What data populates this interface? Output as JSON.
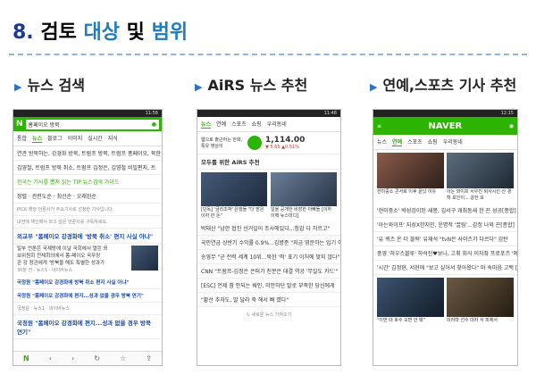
{
  "title": {
    "num": "8.",
    "p1": "검토",
    "p2": "대상",
    "p3": "및",
    "p4": "범위"
  },
  "headers": [
    "뉴스 검색",
    "AiRS 뉴스 추천",
    "연예,스포츠 기사 추천"
  ],
  "p1": {
    "status_time": "11:58",
    "search_query": "홈페이오 방북",
    "tabs": [
      "통합",
      "뉴스",
      "블로그",
      "이미지",
      "실시간",
      "지식"
    ],
    "lines": [
      "연관  방북하는, 강경화 방북, 트럼프 방북, 트럼프 폼페이오, 북한",
      "김영철, 트럼프 방북 취소, 트럼프 김정은, 김영철 비밀편지, 트",
      "한국는 기사를 뽑져 읽는 TIP 뉴스검색 가이드",
      "정렬 · 관련도순 · 최신순 · 오래된순",
      "PICK 해당 언론사가 주요기사로 선정한 기사입니다.",
      "내언에 해인해서 보고 싶은 언론사를 구독하세요."
    ],
    "headline1": "외교부 \"폼페이오 강경화에 '방북 취소' 편지 사실 아냐\"",
    "snippet1": [
      "일부 언론은 국제방에 이날 국회에서 열린 외",
      "보위원회 전체회의에서 폼-페이오 국무장",
      "관 강 장관에게 '방북을 해도 특별한 성과가",
      "30분 전 · 뉴스1 · 네이버뉴스"
    ],
    "headline2": "국정원 \"폼페이오 강경화에 방북 취소 편지 사실 아냐\"",
    "headline3": "국정원 \"폼페이오 강경화에 편지...성과 없을 경우 방북 연기\"",
    "meta3": "국정원 · 뉴스1 · 네이버뉴스",
    "headline4": "국정원 \"폼페이오 강경화에 편지...성과 없을 경우 방북 연기\""
  },
  "p2": {
    "status_time": "11:48",
    "tabs": [
      "뉴스",
      "연예",
      "스포츠",
      "쇼핑",
      "우리동네"
    ],
    "weather": [
      "웹으로 출근하는 한화, 특유 영상이",
      "1,114.00",
      "▼ 5.65  ▲0.51%"
    ],
    "section_title": "모두를 위한 AiRS 추천",
    "cards": [
      "[단독] '금리조작' 은행들 \"더 받은 이자 반 돈\"",
      "일을 공개한 비장한 아빠들 [이하 이해 뉴스미디]"
    ],
    "items": [
      "박태산 \"남한 협진 선거일이 조사에있다...청감 다 치르고\"",
      "국민연금 상반기 수익률 0.9%...김병준 \"지금 영문하는 입기 이거..",
      "송영무 \"군 전력 세계 10위...북한 '적' 표기 이처에 맞지 않다\"",
      "CNN \"트럼프-김정은 은퍼가 친분은 대결 역공 '무일도 카드'\"",
      "[ESC] 언제 참 안되는 쉐인, 미안하단 말로 부족한 당신에게",
      "\"황선 추자도, 발 달라 죽 해서 빠 졌다\""
    ],
    "more": "새로운 뉴스 가져오기"
  },
  "p3": {
    "status_time": "12:15",
    "logo": "NAVER",
    "tabs": [
      "뉴스",
      "연예",
      "스포츠",
      "쇼핑",
      "우리동네"
    ],
    "row1": [
      "한미중소 콘서로 이후 끝났 이유",
      "아는 와이프 서우진 퇴사시킨 산 경학 보인이... 강한 모"
    ],
    "items": [
      "'현미중소' 박성검이된 새봉, 김서구 개최동새 한 끈 성공[종합]",
      "'아는와이프' 지성X한지민, 운명적 '끌림'...감정 나와 끈[종합]",
      "'유 퀴즈 온 더 블럭' 유재석 \"tvN은 사이즈가 다르다\" 감탄",
      "중영 '하우스블루' 하석진♥보나, 고취 회식 이자좌 프로포즈 '예..",
      "'시간' 김정현, 서현에 \"보고 싶어서 찾아왔다\" 마 속마음 고백 [종합]"
    ],
    "row2": [
      "\"이번 대 호수 오면 안 돼\"",
      "미러마 선수 대자 서 피에서"
    ]
  },
  "colors": {
    "naver_green": "#2db400",
    "accent_blue": "#1b7dc4",
    "title_navy": "#1b3a8c"
  }
}
